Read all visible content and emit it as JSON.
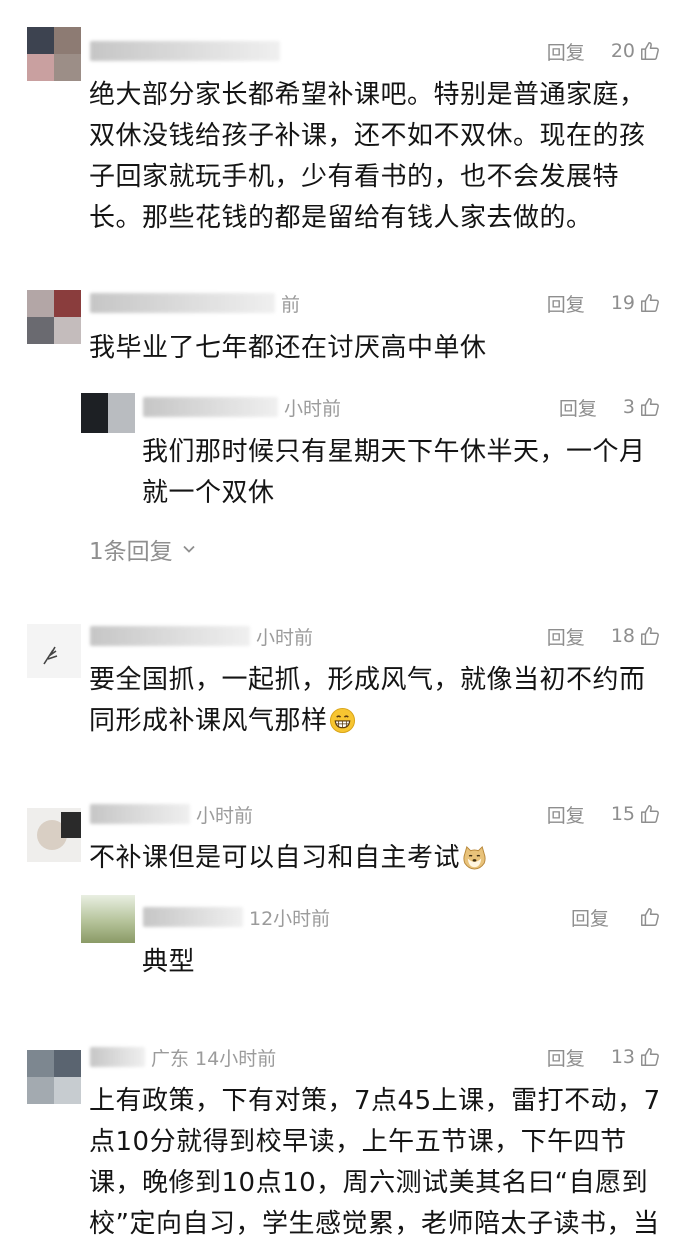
{
  "labels": {
    "reply": "回复"
  },
  "comments": [
    {
      "meta_text": "",
      "likes": "20",
      "text": "绝大部分家长都希望补课吧。特别是普通家庭，双休没钱给孩子补课，还不如不双休。现在的孩子回家就玩手机，少有看书的，也不会发展特长。那些花钱的都是留给有钱人家去做的。"
    },
    {
      "meta_text": "前",
      "likes": "19",
      "text": "我毕业了七年都还在讨厌高中单休",
      "reply": {
        "meta_text": "小时前",
        "likes": "3",
        "text": "我们那时候只有星期天下午休半天，一个月就一个双休"
      },
      "more_replies": "1条回复"
    },
    {
      "meta_text": "小时前",
      "likes": "18",
      "text": "要全国抓，一起抓，形成风气，就像当初不约而同形成补课风气那样",
      "emoji": "grinning-face-emoji"
    },
    {
      "meta_text": "小时前",
      "likes": "15",
      "text": "不补课但是可以自习和自主考试",
      "emoji": "doge-emoji",
      "reply": {
        "meta_text": "12小时前",
        "likes": "",
        "text": "典型"
      }
    },
    {
      "meta_text": "广东 14小时前",
      "likes": "13",
      "text": "上有政策，下有对策，7点45上课，雷打不动，7点10分就得到校早读，上午五节课，下午四节课，晚修到10点10，周六测试美其名曰“自愿到校”定向自习，学生感觉累，老师陪太子读书，当"
    }
  ]
}
